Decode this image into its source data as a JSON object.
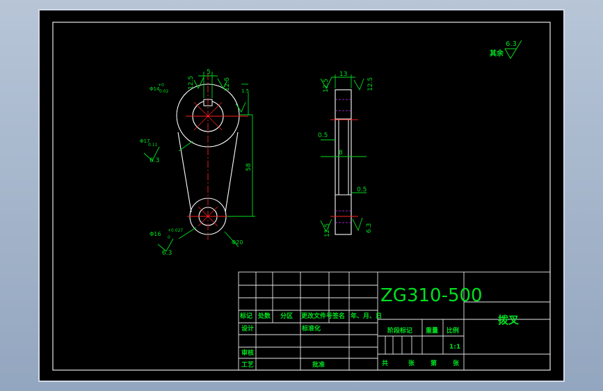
{
  "drawing": {
    "material_code": "ZG310-500",
    "part_name": "拨叉",
    "scale": "1:1",
    "remaining_roughness_label": "其余",
    "remaining_roughness_value": "6.3"
  },
  "title_block": {
    "row_labels": [
      "标记",
      "处数",
      "分区",
      "更改文件号",
      "签名",
      "年、月、日"
    ],
    "design_label": "设计",
    "standard_label": "标准化",
    "stage_mark_label": "阶段标记",
    "weight_label": "重量",
    "scale_label": "比例",
    "review_label": "审核",
    "process_label": "工艺",
    "approve_label": "批准",
    "sheet_total": "共",
    "sheet_unit_1": "张",
    "sheet_no": "第",
    "sheet_unit_2": "张"
  },
  "front_view": {
    "dim_top_width": "5",
    "dim_roughness_top": "12.5",
    "dim_roughness_top2": "12.5",
    "dim_keyway": "1.5",
    "dim_hole_top": "Φ14",
    "dim_hole_top_tol": "0.02",
    "dim_hole_top_tol_up": "+0",
    "dim_roughness_left": "6.3",
    "dim_left_note": "Φ17",
    "dim_left_tol": "0.11",
    "dim_center_dist": "58",
    "dim_hole_bottom": "Φ16",
    "dim_hole_bottom_tol": "+0.027",
    "dim_hole_bottom_tol2": "0",
    "dim_roughness_bottom": "6.3",
    "dim_outer_bottom": "Φ20"
  },
  "side_view": {
    "dim_width": "13",
    "dim_roughness_tl": "12.5",
    "dim_roughness_tr": "12.5",
    "dim_chamfer_top": "0.5",
    "dim_web": "8",
    "dim_chamfer_bottom": "0.5",
    "dim_roughness_bl": "12.5",
    "dim_roughness_br": "6.3"
  }
}
